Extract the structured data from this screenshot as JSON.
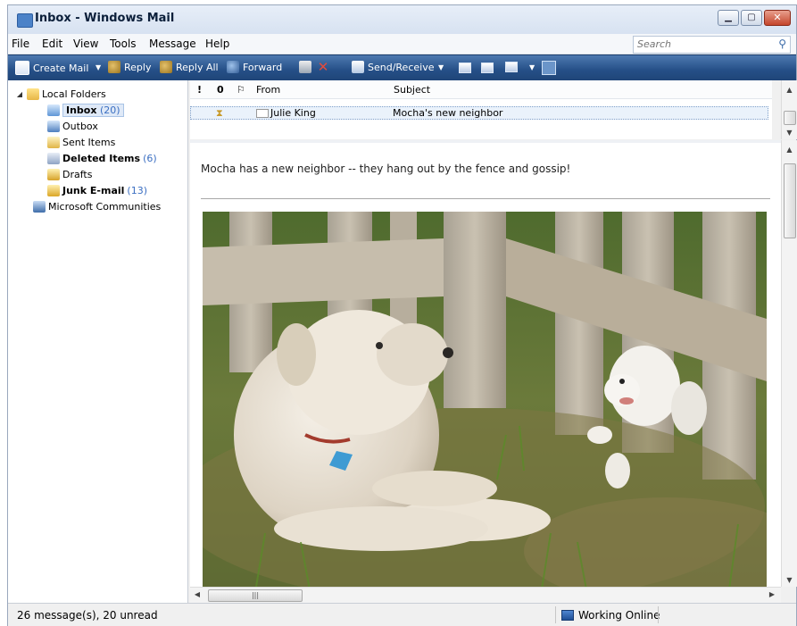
{
  "window": {
    "title": "Inbox - Windows Mail"
  },
  "menu": [
    "File",
    "Edit",
    "View",
    "Tools",
    "Message",
    "Help"
  ],
  "search": {
    "placeholder": "Search"
  },
  "toolbar": {
    "create_mail": "Create Mail",
    "reply": "Reply",
    "reply_all": "Reply All",
    "forward": "Forward",
    "send_receive": "Send/Receive"
  },
  "folders": {
    "root": "Local Folders",
    "items": [
      {
        "label": "Inbox",
        "count": "(20)"
      },
      {
        "label": "Outbox",
        "count": ""
      },
      {
        "label": "Sent Items",
        "count": ""
      },
      {
        "label": "Deleted Items",
        "count": "(6)"
      },
      {
        "label": "Drafts",
        "count": ""
      },
      {
        "label": "Junk E-mail",
        "count": "(13)"
      }
    ],
    "communities": "Microsoft Communities"
  },
  "message_list": {
    "columns": {
      "importance": "!",
      "attachment": "0",
      "flag": "⚐",
      "from": "From",
      "subject": "Subject"
    },
    "rows": [
      {
        "from": "Julie King",
        "subject": "Mocha's new neighbor"
      }
    ]
  },
  "preview": {
    "body": "Mocha has a new neighbor -- they hang out by the fence and gossip!"
  },
  "status": {
    "messages": "26 message(s), 20 unread",
    "connection": "Working Online"
  }
}
